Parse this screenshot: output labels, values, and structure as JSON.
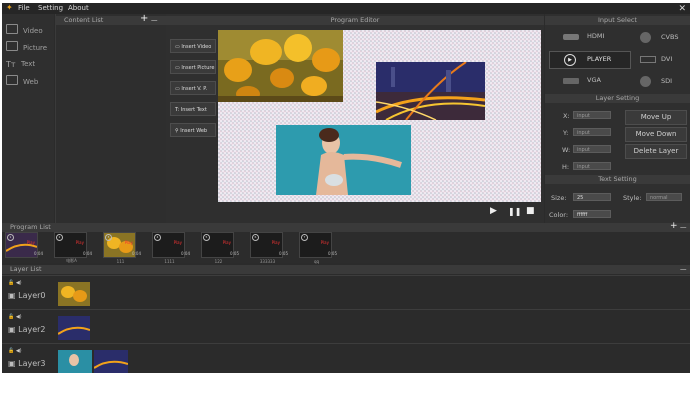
{
  "menu": {
    "file": "File",
    "setting": "Setting",
    "about": "About",
    "close": "✕"
  },
  "content_list": {
    "title": "Content List",
    "add": "+",
    "remove": "—"
  },
  "sidebar": {
    "items": [
      {
        "label": "Video"
      },
      {
        "label": "Picture"
      },
      {
        "label": "Text"
      },
      {
        "label": "Web"
      }
    ]
  },
  "editor": {
    "title": "Program Editor",
    "insert": [
      "Insert Video",
      "Insert Picture",
      "Insert V. P.",
      "Insert Text",
      "Insert Web"
    ],
    "controls": {
      "play": "▶",
      "pause": "❚❚",
      "stop": "■"
    }
  },
  "input_select": {
    "title": "Input Select",
    "options": [
      {
        "label": "HDMI"
      },
      {
        "label": "CVBS"
      },
      {
        "label": "PLAYER"
      },
      {
        "label": "DVI"
      },
      {
        "label": "VGA"
      },
      {
        "label": "SDI"
      }
    ]
  },
  "layer_setting": {
    "title": "Layer Setting",
    "x_label": "X:",
    "y_label": "Y:",
    "w_label": "W:",
    "h_label": "H:",
    "placeholder": "input",
    "move_up": "Move Up",
    "move_down": "Move Down",
    "delete": "Delete Layer"
  },
  "text_setting": {
    "title": "Text Setting",
    "size_label": "Size:",
    "size_value": "25",
    "style_label": "Style:",
    "style_value": "normal",
    "color_label": "Color:",
    "color_value": "ffffff"
  },
  "program_list": {
    "title": "Program List",
    "add": "+",
    "remove": "—",
    "items": [
      {
        "index": "1",
        "name": "",
        "duration": "0:04"
      },
      {
        "index": "2",
        "name": "电影A",
        "duration": "0:04"
      },
      {
        "index": "3",
        "name": "111",
        "duration": "0:04"
      },
      {
        "index": "4",
        "name": "1111",
        "duration": "0:04"
      },
      {
        "index": "5",
        "name": "122",
        "duration": "0:05"
      },
      {
        "index": "6",
        "name": "333333",
        "duration": "0:05"
      },
      {
        "index": "7",
        "name": "qq",
        "duration": "0:05"
      }
    ],
    "play_tag": "Play"
  },
  "layer_list": {
    "title": "Layer List",
    "collapse": "—",
    "layers": [
      {
        "name": "Layer0"
      },
      {
        "name": "Layer2"
      },
      {
        "name": "Layer3"
      }
    ]
  }
}
